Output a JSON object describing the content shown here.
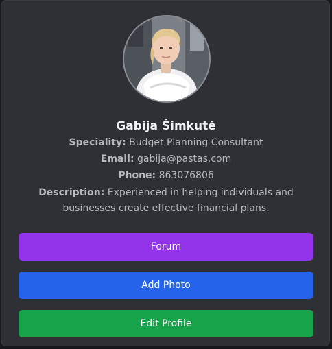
{
  "profile": {
    "name": "Gabija Šimkutė",
    "speciality_label": "Speciality:",
    "speciality": "Budget Planning Consultant",
    "email_label": "Email:",
    "email": "gabija@pastas.com",
    "phone_label": "Phone:",
    "phone": "863076806",
    "description_label": "Description:",
    "description": "Experienced in helping individuals and businesses create effective financial plans."
  },
  "buttons": {
    "forum": "Forum",
    "add_photo": "Add Photo",
    "edit_profile": "Edit Profile"
  },
  "colors": {
    "card_background": "#2f3036",
    "forum": "#9333ea",
    "add_photo": "#2563eb",
    "edit_profile": "#16a34a"
  }
}
